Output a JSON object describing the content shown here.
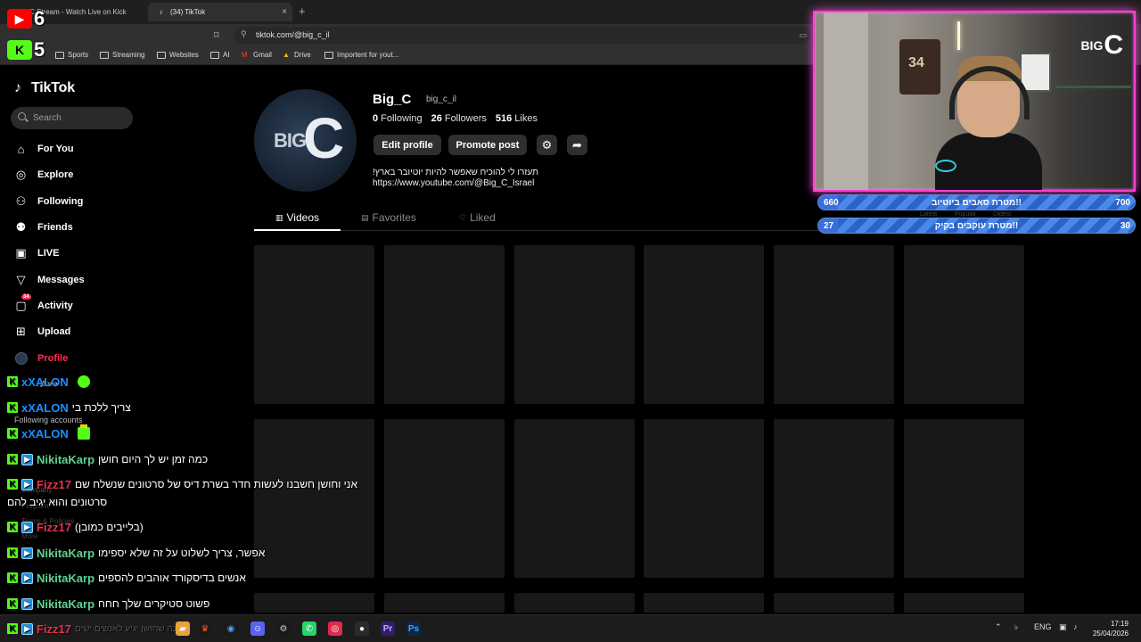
{
  "browser": {
    "tabs": [
      {
        "label": "C Stream - Watch Live on Kick",
        "active": false
      },
      {
        "label": "(34) TikTok",
        "active": true
      }
    ],
    "url": "tiktok.com/@big_c_il",
    "bookmarks": [
      "Sports",
      "Streaming",
      "Websites",
      "AI",
      "Gmail",
      "Drive",
      "Importent for yout..."
    ]
  },
  "tiktok": {
    "logo": "TikTok",
    "search_placeholder": "Search",
    "nav": [
      {
        "label": "For You",
        "icon": "home-icon"
      },
      {
        "label": "Explore",
        "icon": "compass-icon"
      },
      {
        "label": "Following",
        "icon": "following-icon"
      },
      {
        "label": "Friends",
        "icon": "friends-icon"
      },
      {
        "label": "LIVE",
        "icon": "live-icon"
      },
      {
        "label": "Messages",
        "icon": "messages-icon"
      },
      {
        "label": "Activity",
        "icon": "activity-icon",
        "badge": "34"
      },
      {
        "label": "Upload",
        "icon": "upload-icon"
      },
      {
        "label": "Profile",
        "icon": "avatar-icon"
      },
      {
        "label": "More",
        "icon": "more-icon"
      }
    ],
    "sidebar_misc": {
      "following_accounts": "Following accounts",
      "company": "Company",
      "program": "Program",
      "terms": "Terms & Policies",
      "more": "More"
    },
    "profile": {
      "username": "Big_C",
      "handle": "big_c_il",
      "following_count": "0",
      "following_label": "Following",
      "followers_count": "26",
      "followers_label": "Followers",
      "likes_count": "516",
      "likes_label": "Likes",
      "edit_button": "Edit profile",
      "promote_button": "Promote post",
      "bio": "!תעזרו לי להוכיח שאפשר להיות יוטיובר בארץ",
      "link": "https://www.youtube.com/@Big_C_Israel",
      "avatar_text_big": "BIG",
      "avatar_text_c": "C"
    },
    "tabs": [
      {
        "label": "Videos",
        "active": true
      },
      {
        "label": "Favorites",
        "active": false
      },
      {
        "label": "Liked",
        "active": false
      }
    ],
    "sort_options": [
      "Latest",
      "Popular",
      "Oldest"
    ]
  },
  "stream": {
    "counters": [
      {
        "platform": "youtube-icon",
        "value": "6"
      },
      {
        "platform": "kick-icon",
        "value": "5"
      }
    ],
    "cam_brand": "BIG",
    "cam_brand_c": "C",
    "jersey_number": "34",
    "goals": [
      {
        "start": "660",
        "title": "!!מטרת סאבים ביוטיוב",
        "end": "700"
      },
      {
        "start": "27",
        "title": "!!מטרת עוקבים בקיק",
        "end": "30"
      }
    ],
    "chat": [
      {
        "icon": "kick",
        "user": "xXALON",
        "color": "#1d8fff",
        "msg": "",
        "emote": "round"
      },
      {
        "icon": "kick",
        "user": "xXALON",
        "color": "#1d8fff",
        "msg": "צריך ללכת בי",
        "emote": ""
      },
      {
        "icon": "kick",
        "user": "xXALON",
        "color": "#1d8fff",
        "msg": "",
        "emote": "crown"
      },
      {
        "icon": "kick-badge",
        "user": "NikitaKarp",
        "color": "#5fd38f",
        "msg": "כמה זמן יש לך היום חושן",
        "emote": ""
      },
      {
        "icon": "kick-badge",
        "user": "Fizz17",
        "color": "#e8304f",
        "msg": "אני וחושן חשבנו לעשות חדר בשרת דיס של סרטונים שנשלח שם",
        "emote": ""
      },
      {
        "icon": "kick-badge",
        "user": "Fizz17",
        "color": "#e8304f",
        "msg": "(בלייבים כמובן)",
        "emote": ""
      },
      {
        "icon": "kick-badge",
        "user": "NikitaKarp",
        "color": "#5fd38f",
        "msg": "אפשר, צריך לשלוט על זה שלא יספימו",
        "emote": ""
      },
      {
        "icon": "kick-badge",
        "user": "NikitaKarp",
        "color": "#5fd38f",
        "msg": "אנשים בדיסקורד אוהבים להספים",
        "emote": ""
      },
      {
        "icon": "kick-badge",
        "user": "NikitaKarp",
        "color": "#5fd38f",
        "msg": "פשוט סטיקרים שלך חחח",
        "emote": ""
      },
      {
        "icon": "kick-badge",
        "user": "Fizz17",
        "color": "#e8304f",
        "msg": "בשנה שחושן יגיע לאנשים ישים",
        "emote": ""
      }
    ],
    "chat_continuation": "סרטונים והוא יגיב להם"
  },
  "taskbar": {
    "lang": "ENG",
    "time": "17:19",
    "date": "25/04/2026"
  }
}
